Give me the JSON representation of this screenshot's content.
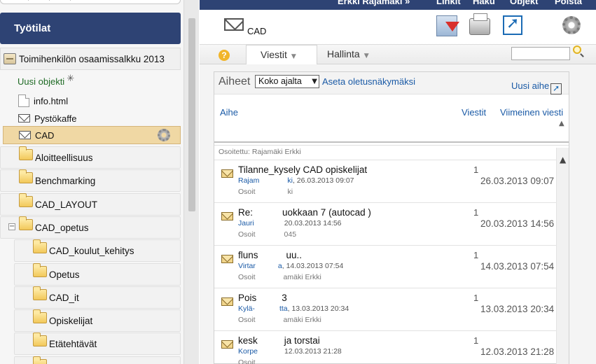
{
  "sidebar": {
    "header": "Työtilat",
    "root": "Toimihenkilön osaamissalkku 2013",
    "new_object": "Uusi objekti",
    "items": [
      "info.html",
      "Pystökaffe",
      "CAD"
    ],
    "folders": [
      "Aloitteellisuus",
      "Benchmarking",
      "CAD_LAYOUT",
      "CAD_opetus"
    ],
    "expander": "−",
    "subfolders": [
      "CAD_koulut_kehitys",
      "Opetus",
      "CAD_it",
      "Opiskelijat",
      "Etätehtävät"
    ]
  },
  "topbar": {
    "user": "Erkki Rajamäki »",
    "links": [
      "Linkit",
      "Haku",
      "Objekt",
      "Poista"
    ]
  },
  "main": {
    "title": "CAD",
    "tabs": [
      "Viestit",
      "Hallinta"
    ],
    "help": "?",
    "search": {
      "placeholder": "",
      "value": ""
    },
    "panel": {
      "label": "Aiheet",
      "period": "Koko ajalta",
      "set_default": "Aseta oletusnäkymäksi",
      "new_topic": "Uusi aihe",
      "columns": {
        "topic": "Aihe",
        "messages": "Viestit",
        "last": "Viimeinen viesti"
      },
      "addressed_top": "Osoitettu: Rajamäki Erkki"
    },
    "messages": [
      {
        "title": "Tilanne_kysely CAD opiskelijat",
        "who": "Rajam",
        "whoTail": "ki",
        "date_small": ", 26.03.2013 09:07",
        "addr": "Osoit",
        "addrTail": "ki",
        "count": "1",
        "date": "26.03.2013 09:07"
      },
      {
        "title": "Re:",
        "titleTail": "uokkaan 7 (autocad )",
        "who": "Jauri",
        "date_small": "20.03.2013 14:56",
        "addr": "Osoit",
        "addrTail": "045",
        "count": "1",
        "date": "20.03.2013 14:56"
      },
      {
        "title": "fluns",
        "titleTail": "uu..",
        "who": "Virtar",
        "whoTail": "a",
        "date_small": ", 14.03.2013 07:54",
        "addr": "Osoit",
        "addrTail": "amäki Erkki",
        "count": "1",
        "date": "14.03.2013 07:54"
      },
      {
        "title": "Pois",
        "titleTail": "3",
        "who": "Kylä-",
        "whoTail": "tta",
        "date_small": ", 13.03.2013 20:34",
        "addr": "Osoit",
        "addrTail": "amäki Erkki",
        "count": "1",
        "date": "13.03.2013 20:34"
      },
      {
        "title": "kesk",
        "titleTail": "ja torstai",
        "who": "Korpe",
        "date_small": "12.03.2013 21:28",
        "addr": "Osoit",
        "count": "1",
        "date": "12.03.2013 21:28"
      }
    ]
  }
}
